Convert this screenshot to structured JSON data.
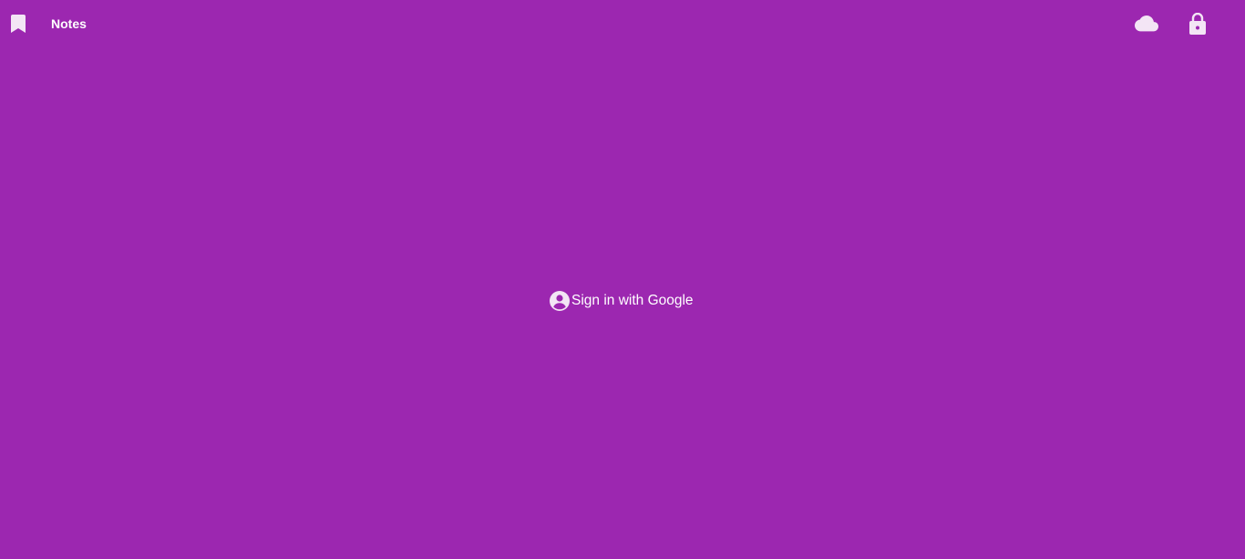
{
  "app": {
    "title": "Notes"
  },
  "header": {
    "icons": {
      "left": "bookmark-icon",
      "right": [
        "cloud-icon",
        "lock-icon"
      ]
    }
  },
  "main": {
    "signin_label": "Sign in with Google",
    "signin_icon": "account-circle-icon"
  },
  "colors": {
    "background": "#9c27b0",
    "foreground": "#ffffff",
    "icon_tint": "#f3e5f5"
  }
}
